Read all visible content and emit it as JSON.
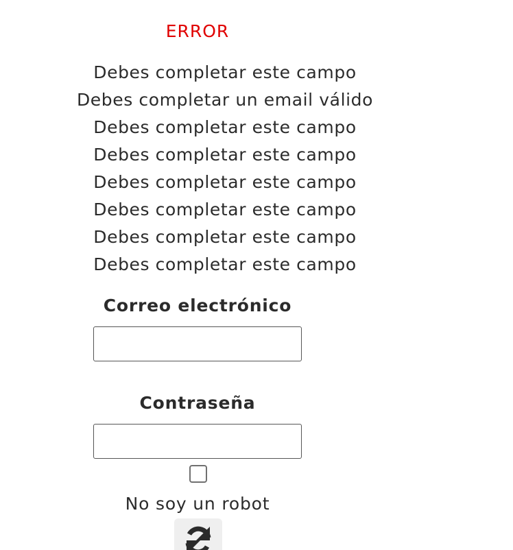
{
  "form": {
    "error_title": "ERROR",
    "errors": [
      "Debes completar este campo",
      "Debes completar un email válido",
      "Debes completar este campo",
      "Debes completar este campo",
      "Debes completar este campo",
      "Debes completar este campo",
      "Debes completar este campo",
      "Debes completar este campo"
    ],
    "email_label": "Correo electrónico",
    "email_value": "",
    "password_label": "Contraseña",
    "password_value": "",
    "captcha_checked": false,
    "captcha_label": "No soy un robot",
    "refresh_icon": "refresh-icon"
  },
  "colors": {
    "error": "#e00000",
    "text": "#2b2b2b",
    "input_border": "#555555",
    "refresh_bg": "#efefef"
  }
}
